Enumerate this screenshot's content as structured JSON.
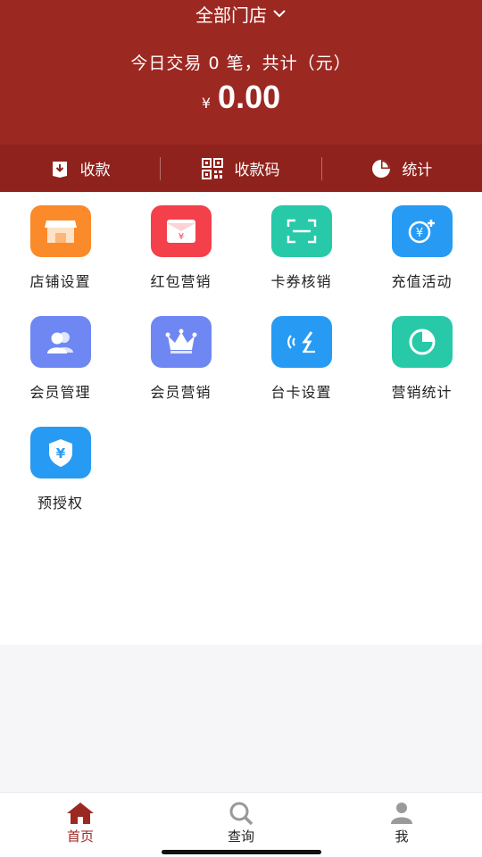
{
  "header": {
    "store_selector": "全部门店",
    "summary": "今日交易 0 笔，共计（元）",
    "currency": "¥",
    "amount": "0.00",
    "bg_color": "#9c2822"
  },
  "actions": [
    {
      "label": "收款",
      "icon": "download-icon"
    },
    {
      "label": "收款码",
      "icon": "qr-code-icon"
    },
    {
      "label": "统计",
      "icon": "pie-chart-icon"
    }
  ],
  "grid": [
    {
      "label": "店铺设置",
      "icon": "store-icon",
      "color": "#fb8a2a"
    },
    {
      "label": "红包营销",
      "icon": "red-envelope-icon",
      "color": "#f4404b"
    },
    {
      "label": "卡券核销",
      "icon": "scan-icon",
      "color": "#27c9a9"
    },
    {
      "label": "充值活动",
      "icon": "recharge-icon",
      "color": "#279bf4"
    },
    {
      "label": "会员管理",
      "icon": "members-icon",
      "color": "#6e87f2"
    },
    {
      "label": "会员营销",
      "icon": "crown-icon",
      "color": "#6e87f2"
    },
    {
      "label": "台卡设置",
      "icon": "nfc-icon",
      "color": "#279bf4"
    },
    {
      "label": "营销统计",
      "icon": "pie-chart-icon",
      "color": "#27c9a9"
    },
    {
      "label": "预授权",
      "icon": "shield-yen-icon",
      "color": "#279bf4"
    }
  ],
  "tabbar": [
    {
      "label": "首页",
      "icon": "home-icon",
      "active": true
    },
    {
      "label": "查询",
      "icon": "search-icon",
      "active": false
    },
    {
      "label": "我",
      "icon": "user-icon",
      "active": false
    }
  ]
}
